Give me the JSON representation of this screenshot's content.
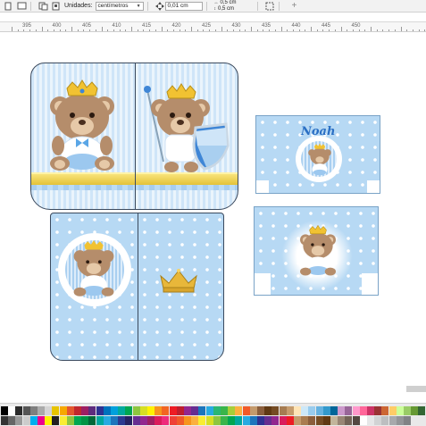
{
  "toolbar": {
    "units_label": "Unidades:",
    "units_value": "centímetros",
    "nudge_value": "0,01 cm",
    "dup_x": "0,5 cm",
    "dup_y": "0,5 cm"
  },
  "ruler": {
    "labels": [
      "395",
      "400",
      "405",
      "410",
      "415",
      "420",
      "425",
      "430",
      "435",
      "440",
      "445",
      "450"
    ]
  },
  "artwork": {
    "name_text": "Noah"
  },
  "colors": {
    "light_blue": "#b7d9f4",
    "stripe_blue": "#cfe5f8",
    "gold": "#e3c238",
    "bear_brown": "#b58d6b",
    "cut_line": "#3b4a5e"
  },
  "palette": {
    "swatches": [
      "#000000",
      "#ffffff",
      "#2b2b2b",
      "#555555",
      "#7f7f7f",
      "#aaaaaa",
      "#d4d4d4",
      "#e8c400",
      "#f6a800",
      "#e4572e",
      "#c0282e",
      "#9e1f63",
      "#5e2b7e",
      "#2e3192",
      "#0072bc",
      "#00a0dc",
      "#00a99d",
      "#00a651",
      "#8dc63f",
      "#d7df23",
      "#fff200",
      "#f7941d",
      "#f26522",
      "#ed1c24",
      "#be1e2d",
      "#92278f",
      "#662d91",
      "#1b75bc",
      "#27aae1",
      "#2bb673",
      "#39b54a",
      "#a6ce39",
      "#fbb040",
      "#f15a29",
      "#c49a6c",
      "#8b5e3c",
      "#603913",
      "#754c24",
      "#a67c52",
      "#c69c6d",
      "#ffe4b5",
      "#cde8f8",
      "#99ccee",
      "#66b2e0",
      "#3399cc",
      "#006699",
      "#cc99cc",
      "#996699",
      "#ff99cc",
      "#ff6699",
      "#cc3366",
      "#993333",
      "#cc6633",
      "#ffcc66",
      "#ccff99",
      "#99cc66",
      "#669933",
      "#336633"
    ],
    "swatches_row2": [
      "#333333",
      "#666666",
      "#999999",
      "#cccccc",
      "#00aeef",
      "#ec008c",
      "#fff200",
      "#231f20",
      "#f9ed32",
      "#8dc63f",
      "#00a651",
      "#009444",
      "#006838",
      "#00a79d",
      "#27aae1",
      "#1c75bc",
      "#2b3990",
      "#262262",
      "#662d91",
      "#92278f",
      "#9e1f63",
      "#da1c5c",
      "#ee2a7b",
      "#ef4136",
      "#f15a29",
      "#f7941d",
      "#fbb040",
      "#f9ed32",
      "#d7df23",
      "#8dc63f",
      "#39b54a",
      "#00a651",
      "#00a79d",
      "#27aae1",
      "#1c75bc",
      "#2e3192",
      "#652d90",
      "#91278f",
      "#d91c5c",
      "#ed1c24",
      "#c49a6c",
      "#a97c50",
      "#8b5e3c",
      "#754c24",
      "#603913",
      "#c2b59b",
      "#998675",
      "#736357",
      "#534741",
      "#ffffff",
      "#e6e7e8",
      "#d1d3d4",
      "#bcbec0",
      "#a7a9ac",
      "#939598",
      "#808285"
    ]
  }
}
